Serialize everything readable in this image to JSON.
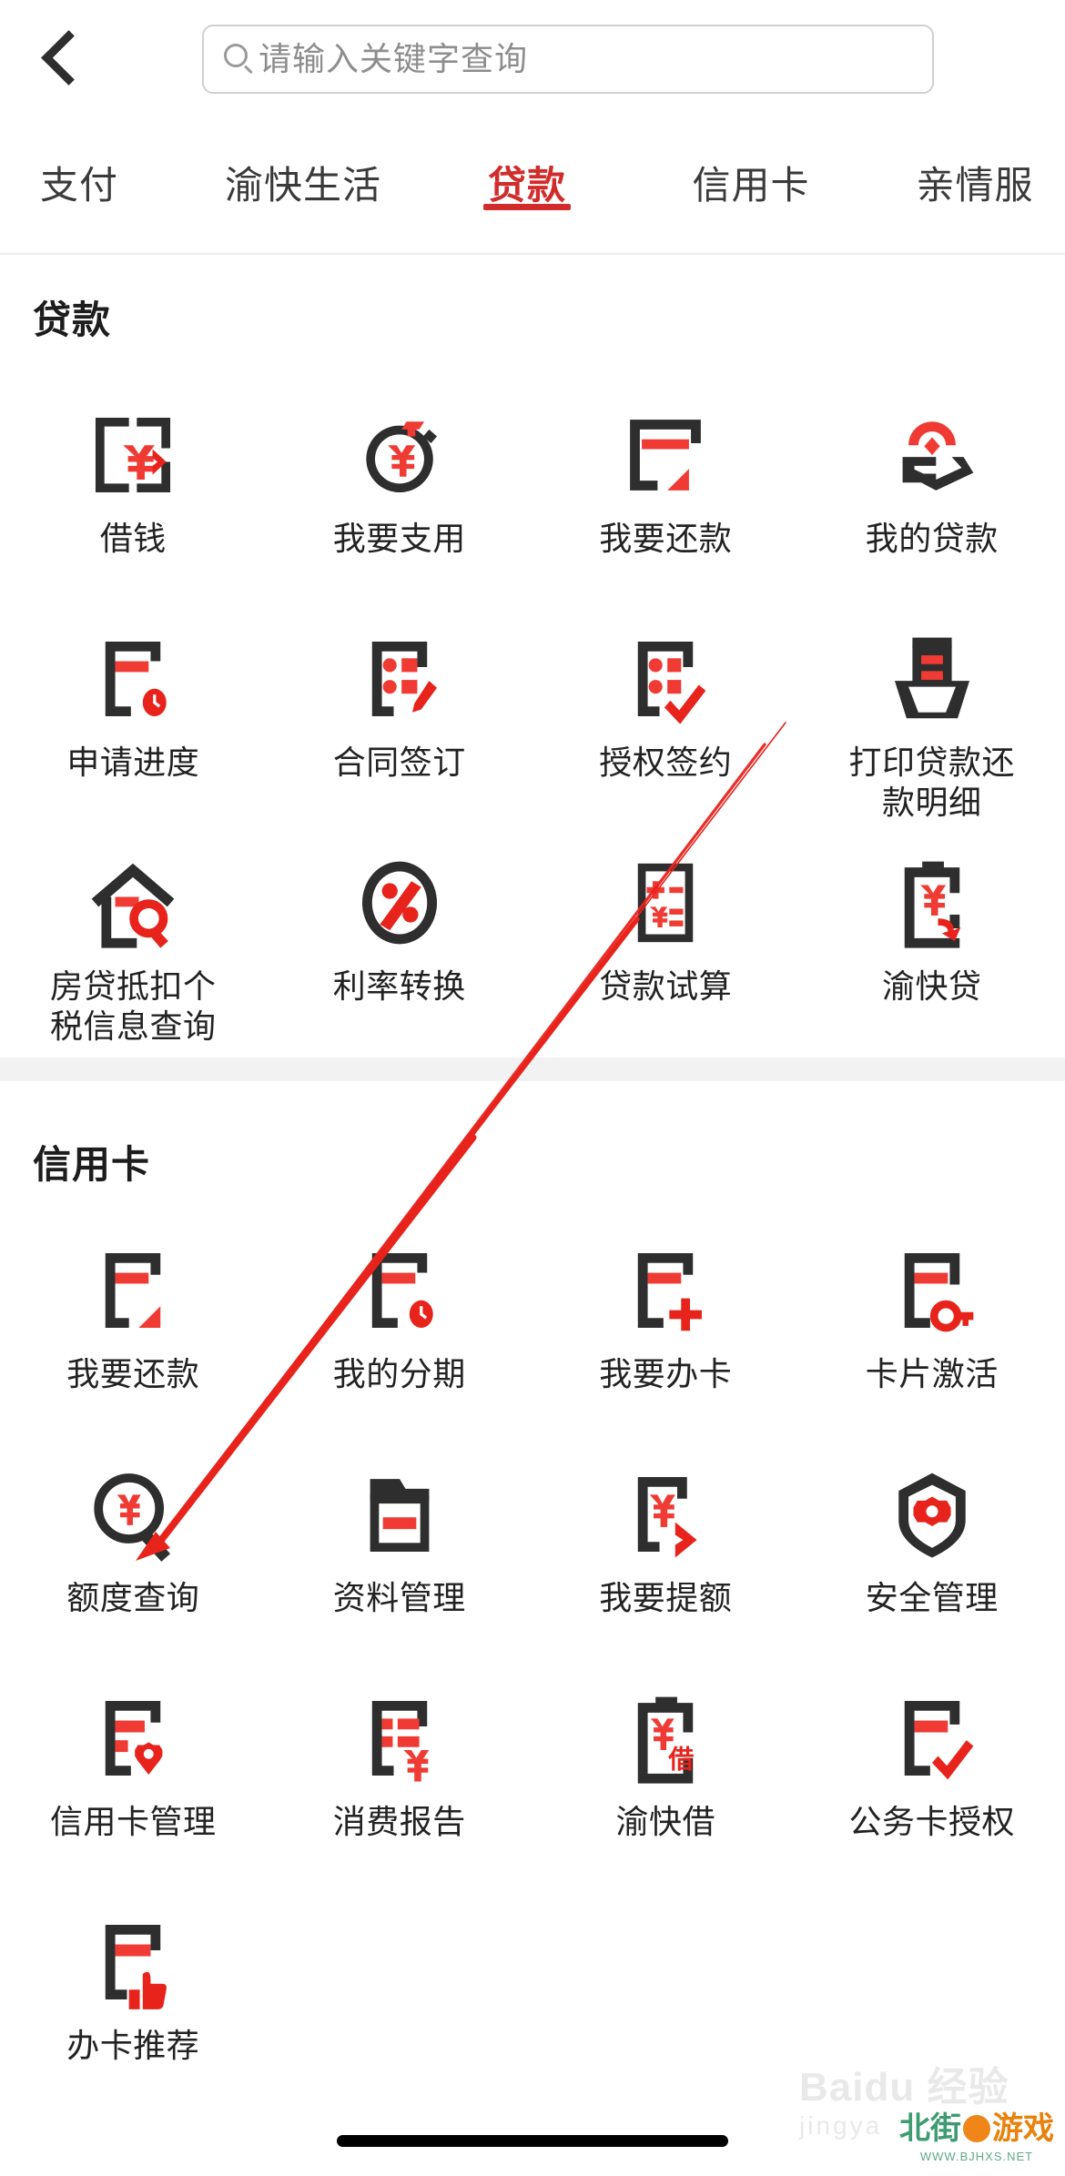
{
  "header": {
    "back_icon": "chevron-left-icon",
    "search": {
      "icon": "search-icon",
      "placeholder": "请输入关键字查询",
      "value": ""
    }
  },
  "tabs": [
    {
      "label": "支付",
      "active": false
    },
    {
      "label": "渝快生活",
      "active": false
    },
    {
      "label": "贷款",
      "active": true
    },
    {
      "label": "信用卡",
      "active": false
    },
    {
      "label": "亲情服",
      "active": false
    }
  ],
  "accent_color": "#d22b2b",
  "sections": [
    {
      "title": "贷款",
      "items": [
        {
          "label": "借钱",
          "icon": "card-yen-arrow-icon"
        },
        {
          "label": "我要支用",
          "icon": "stopwatch-yen-icon"
        },
        {
          "label": "我要还款",
          "icon": "card-repay-icon"
        },
        {
          "label": "我的贷款",
          "icon": "hand-coin-icon"
        },
        {
          "label": "申请进度",
          "icon": "card-clock-icon"
        },
        {
          "label": "合同签订",
          "icon": "list-pen-icon"
        },
        {
          "label": "授权签约",
          "icon": "list-check-icon"
        },
        {
          "label": "打印贷款还\n款明细",
          "icon": "printer-icon"
        },
        {
          "label": "房贷抵扣个\n税信息查询",
          "icon": "house-search-icon"
        },
        {
          "label": "利率转换",
          "icon": "percent-circle-icon"
        },
        {
          "label": "贷款试算",
          "icon": "calculator-icon"
        },
        {
          "label": "渝快贷",
          "icon": "clipboard-yen-arrow-icon"
        }
      ]
    },
    {
      "title": "信用卡",
      "items": [
        {
          "label": "我要还款",
          "icon": "card-repay-icon"
        },
        {
          "label": "我的分期",
          "icon": "card-clock-icon"
        },
        {
          "label": "我要办卡",
          "icon": "card-plus-icon"
        },
        {
          "label": "卡片激活",
          "icon": "card-key-icon"
        },
        {
          "label": "额度查询",
          "icon": "magnifier-yen-icon"
        },
        {
          "label": "资料管理",
          "icon": "folder-icon"
        },
        {
          "label": "我要提额",
          "icon": "card-yen-arrow-icon"
        },
        {
          "label": "安全管理",
          "icon": "shield-gear-icon"
        },
        {
          "label": "信用卡管理",
          "icon": "card-gear-icon"
        },
        {
          "label": "消费报告",
          "icon": "report-yen-icon"
        },
        {
          "label": "渝快借",
          "icon": "clipboard-jie-icon"
        },
        {
          "label": "公务卡授权",
          "icon": "card-check-icon"
        },
        {
          "label": "办卡推荐",
          "icon": "card-thumbup-icon"
        }
      ]
    }
  ],
  "annotation": {
    "type": "arrow",
    "color": "#e8231c",
    "from_label": "授权签约",
    "to_label": "额度查询"
  },
  "watermarks": {
    "baidu_main": "Baidu 经验",
    "baidu_sub": "jingya",
    "bjhx_left": "北街",
    "bjhx_right": "游戏",
    "bjhx_url": "WWW.BJHXS.NET"
  },
  "home_indicator": "home-indicator"
}
